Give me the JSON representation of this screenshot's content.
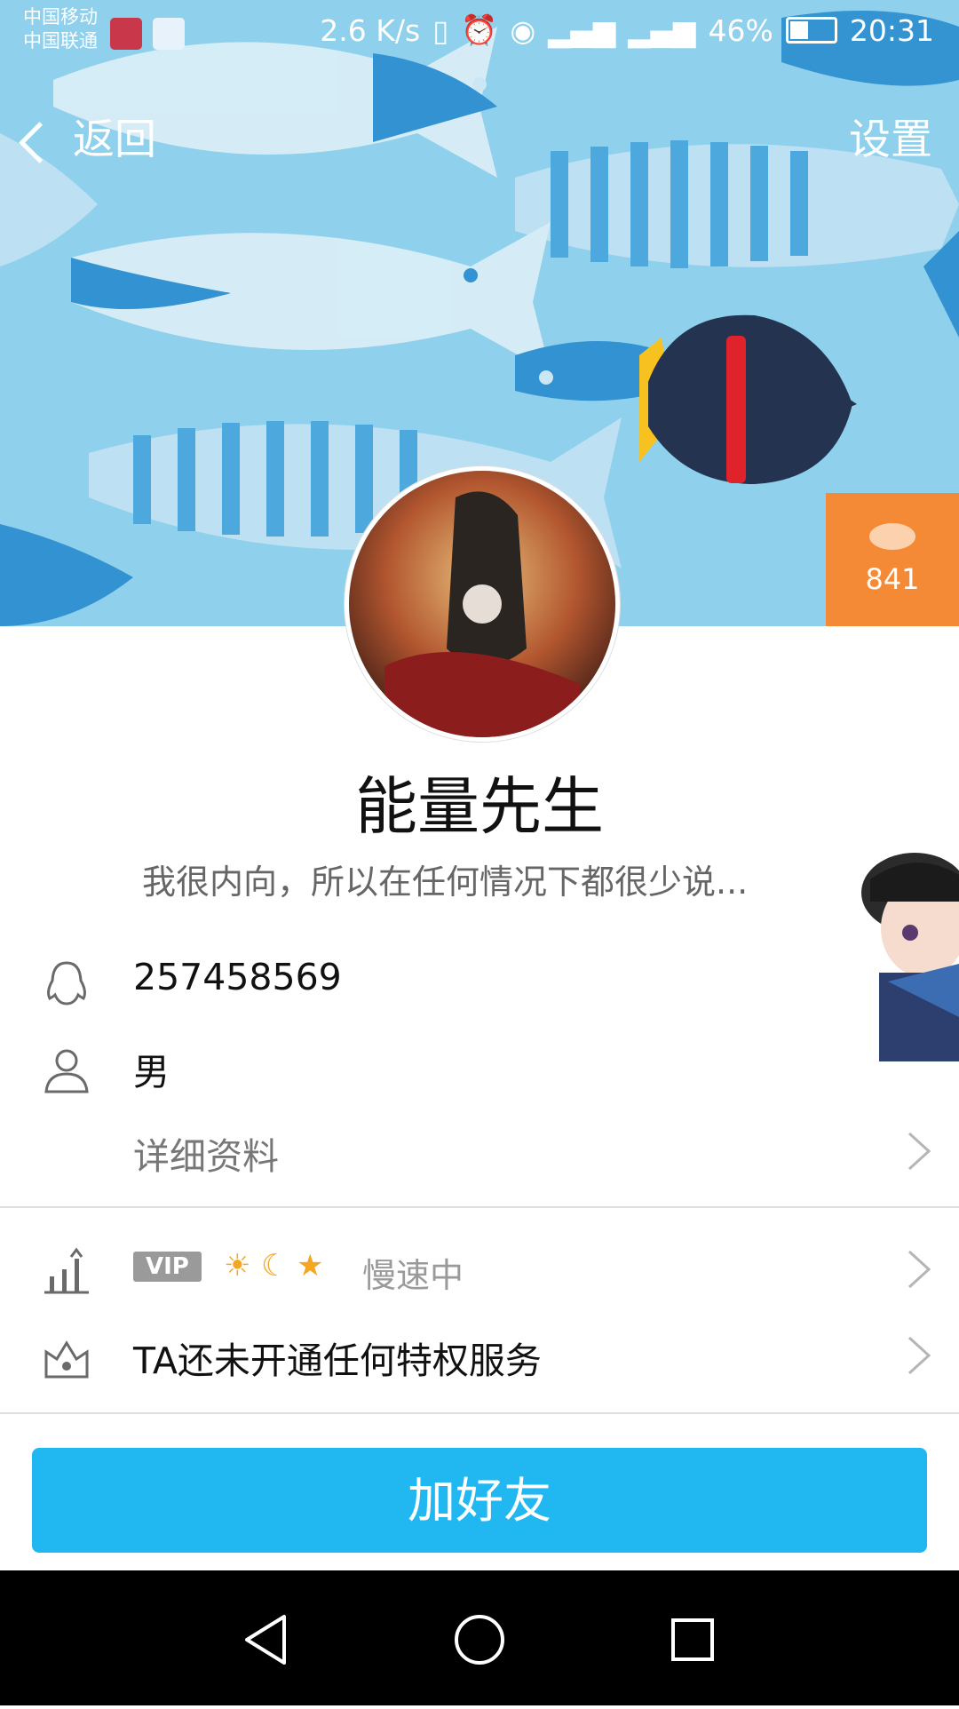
{
  "status_bar": {
    "carrier1": "中国移动",
    "carrier2": "中国联通",
    "speed": "2.6 K/s",
    "battery": "46%",
    "time": "20:31"
  },
  "header": {
    "back_label": "返回",
    "settings_label": "设置"
  },
  "popularity": {
    "count": "841"
  },
  "profile": {
    "name": "能量先生",
    "signature": "我很内向，所以在任何情况下都很少说...",
    "qq_number": "257458569",
    "gender": "男",
    "details_label": "详细资料"
  },
  "level": {
    "vip_label": "VIP",
    "speed_text": "慢速中"
  },
  "privilege": {
    "text": "TA还未开通任何特权服务"
  },
  "action": {
    "add_friend": "加好友"
  },
  "colors": {
    "accent": "#21b7f0",
    "badge": "#f58a36"
  }
}
